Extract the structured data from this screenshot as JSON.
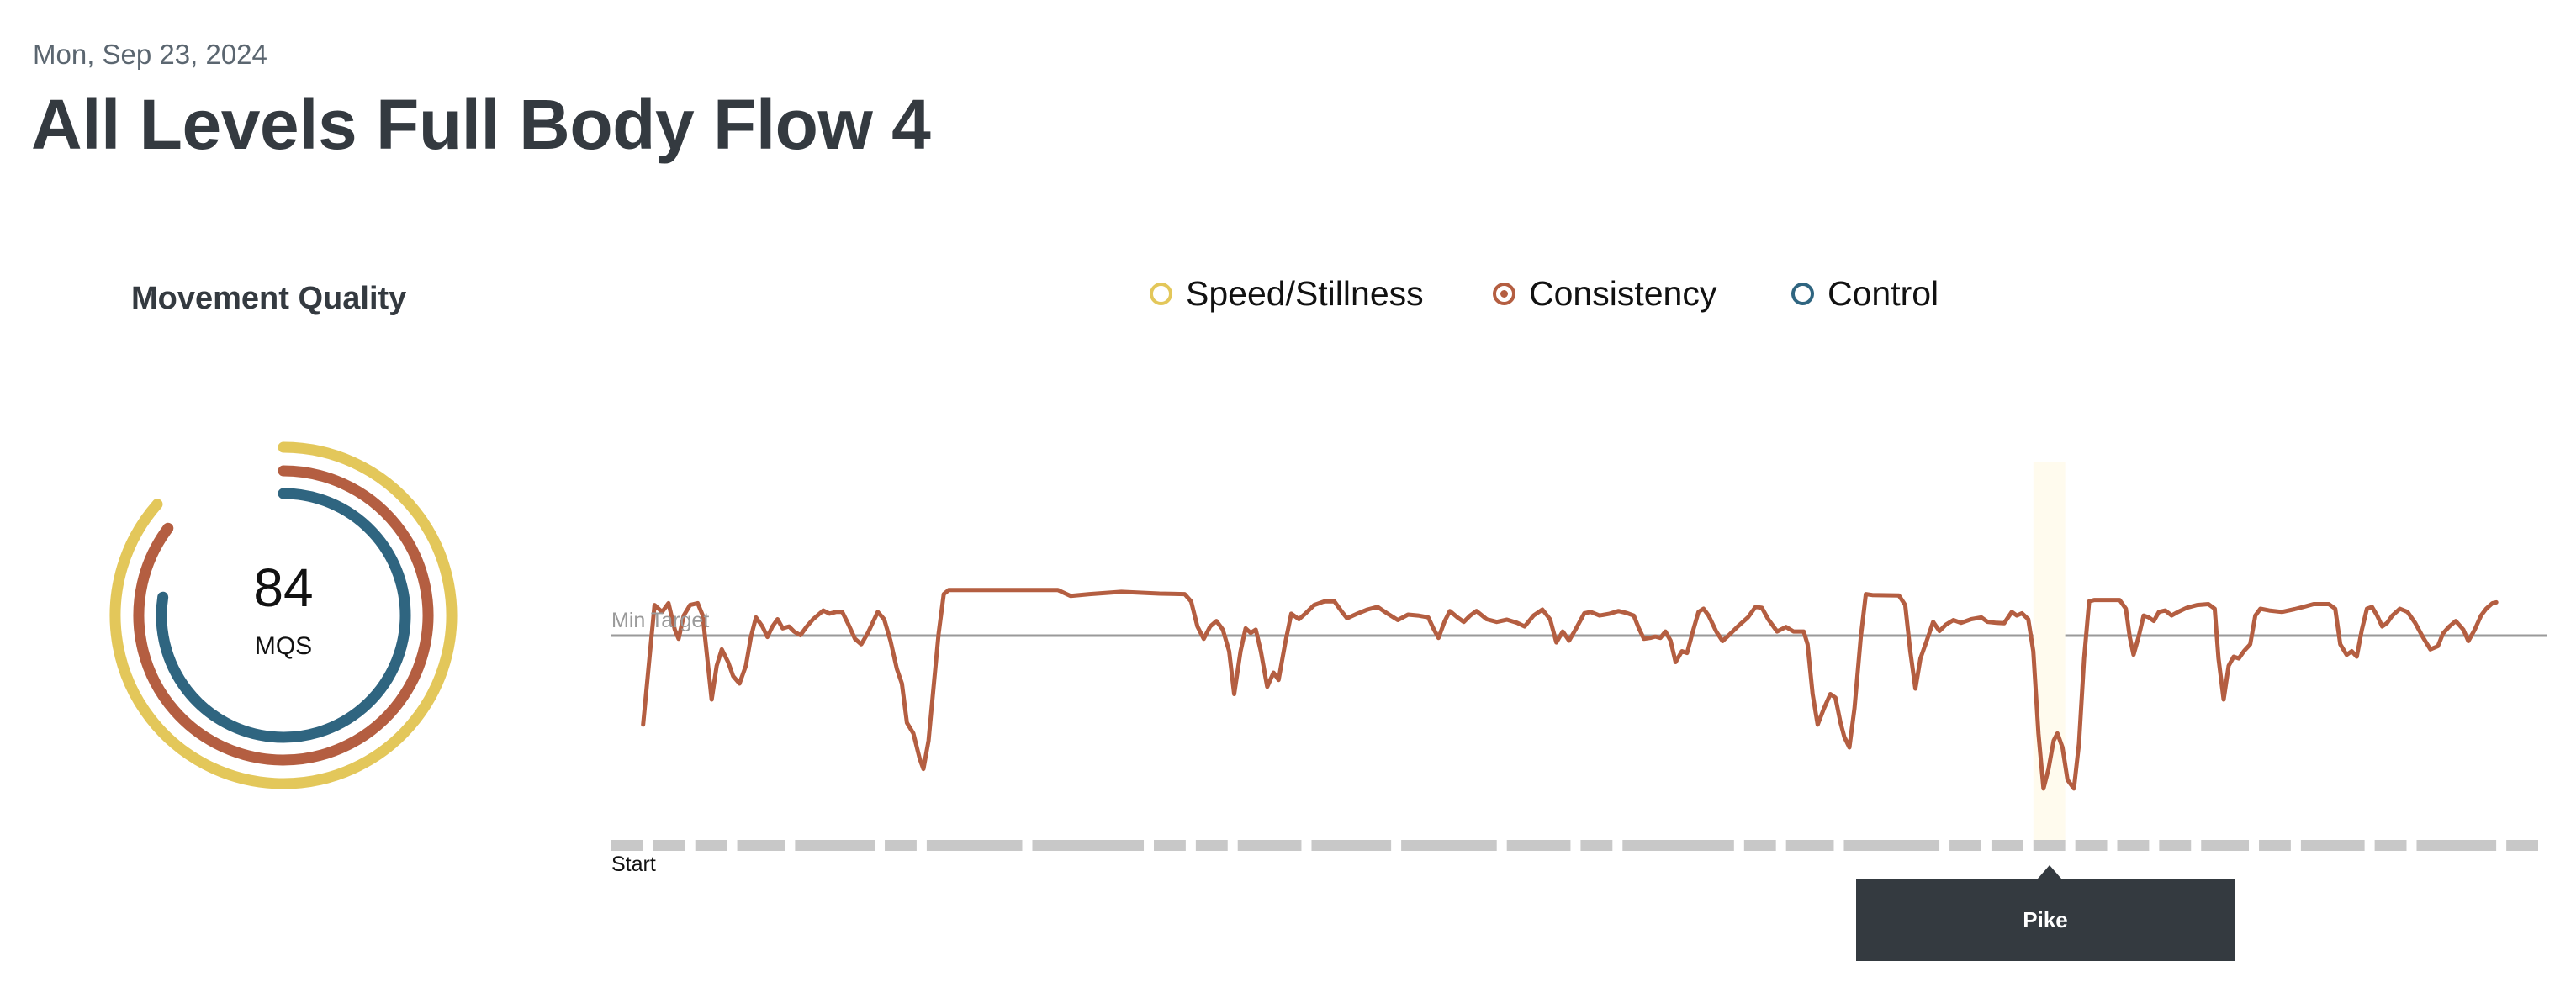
{
  "header": {
    "date": "Mon, Sep 23, 2024",
    "title": "All Levels Full Body Flow 4"
  },
  "movement_quality": {
    "title": "Movement Quality",
    "score": "84",
    "score_label": "MQS",
    "rings": [
      {
        "metric": "Speed/Stillness",
        "fraction": 0.865,
        "color": "#e3c75a"
      },
      {
        "metric": "Consistency",
        "fraction": 0.853,
        "color": "#b45e41"
      },
      {
        "metric": "Control",
        "fraction": 0.774,
        "color": "#2f6580"
      }
    ]
  },
  "legend": [
    {
      "label": "Speed/Stillness",
      "color": "#e3c75a",
      "selected": false
    },
    {
      "label": "Consistency",
      "color": "#b45e41",
      "selected": true
    },
    {
      "label": "Control",
      "color": "#2f6580",
      "selected": false
    }
  ],
  "colors": {
    "line": "#b45e41",
    "min_target": "#9a9a9a",
    "segment": "#c8c8c8",
    "highlight": "#fffbee",
    "tooltip_bg": "#343a40"
  },
  "chart_data": {
    "type": "line",
    "series": [
      {
        "name": "Consistency",
        "color": "#b45e41"
      }
    ],
    "x_range": [
      0,
      1519
    ],
    "y_range": [
      36,
      80
    ],
    "min_target": {
      "label": "Min Target",
      "value": 70
    },
    "start_label": "Start",
    "segment_units": [
      2,
      2,
      2,
      3,
      5,
      2,
      6,
      7,
      2,
      2,
      4,
      5,
      6,
      4,
      2,
      7,
      2,
      3,
      6,
      2,
      2,
      2,
      2,
      2,
      2,
      3,
      2,
      4,
      2,
      5,
      2
    ],
    "highlighted_segment": 21,
    "tooltip": "Pike",
    "points": [
      [
        25,
        50.5
      ],
      [
        30,
        65
      ],
      [
        34,
        76.7
      ],
      [
        40,
        75.2
      ],
      [
        45,
        77.1
      ],
      [
        50,
        71.3
      ],
      [
        53,
        69.3
      ],
      [
        57,
        74.4
      ],
      [
        62,
        76.7
      ],
      [
        68,
        77.1
      ],
      [
        72,
        74.4
      ],
      [
        75,
        66.6
      ],
      [
        79,
        56
      ],
      [
        83,
        63.4
      ],
      [
        87,
        67
      ],
      [
        92,
        64.2
      ],
      [
        96,
        61.1
      ],
      [
        101,
        59.5
      ],
      [
        106,
        63.4
      ],
      [
        110,
        69.7
      ],
      [
        114,
        74
      ],
      [
        119,
        72
      ],
      [
        123,
        69.7
      ],
      [
        127,
        72
      ],
      [
        131,
        73.6
      ],
      [
        135,
        71.6
      ],
      [
        140,
        72
      ],
      [
        144,
        70.9
      ],
      [
        149,
        70.1
      ],
      [
        154,
        72
      ],
      [
        159,
        73.6
      ],
      [
        167,
        75.5
      ],
      [
        172,
        74.8
      ],
      [
        177,
        75.2
      ],
      [
        182,
        75.2
      ],
      [
        187,
        72.4
      ],
      [
        192,
        69.3
      ],
      [
        197,
        68.1
      ],
      [
        202,
        70.5
      ],
      [
        210,
        75.2
      ],
      [
        215,
        73.6
      ],
      [
        220,
        68.9
      ],
      [
        225,
        62.7
      ],
      [
        229,
        59.5
      ],
      [
        233,
        50.9
      ],
      [
        238,
        48.6
      ],
      [
        243,
        43.1
      ],
      [
        246,
        40.8
      ],
      [
        250,
        47
      ],
      [
        254,
        58.8
      ],
      [
        258,
        70.5
      ],
      [
        262,
        79.1
      ],
      [
        266,
        80
      ],
      [
        352,
        80
      ],
      [
        362,
        78.7
      ],
      [
        377,
        79.1
      ],
      [
        402,
        79.6
      ],
      [
        432,
        79.2
      ],
      [
        452,
        79.1
      ],
      [
        457,
        77.5
      ],
      [
        462,
        72
      ],
      [
        467,
        69.3
      ],
      [
        472,
        72
      ],
      [
        477,
        73.2
      ],
      [
        482,
        71.3
      ],
      [
        487,
        66.6
      ],
      [
        491,
        57.2
      ],
      [
        496,
        66.6
      ],
      [
        500,
        71.6
      ],
      [
        504,
        70.6
      ],
      [
        508,
        71.3
      ],
      [
        512,
        66.6
      ],
      [
        517,
        58.8
      ],
      [
        522,
        61.9
      ],
      [
        526,
        60.3
      ],
      [
        531,
        68.1
      ],
      [
        536,
        74.8
      ],
      [
        542,
        73.6
      ],
      [
        547,
        74.8
      ],
      [
        554,
        76.7
      ],
      [
        562,
        77.5
      ],
      [
        570,
        77.5
      ],
      [
        576,
        75.2
      ],
      [
        580,
        73.8
      ],
      [
        588,
        74.8
      ],
      [
        596,
        75.7
      ],
      [
        604,
        76.3
      ],
      [
        612,
        74.8
      ],
      [
        620,
        73.4
      ],
      [
        628,
        74.6
      ],
      [
        636,
        74.4
      ],
      [
        644,
        74
      ],
      [
        648,
        71.6
      ],
      [
        652,
        69.5
      ],
      [
        657,
        73.2
      ],
      [
        661,
        75.4
      ],
      [
        667,
        74
      ],
      [
        672,
        73
      ],
      [
        677,
        74.4
      ],
      [
        682,
        75.4
      ],
      [
        690,
        73.6
      ],
      [
        698,
        73
      ],
      [
        706,
        73.5
      ],
      [
        714,
        72.8
      ],
      [
        720,
        72
      ],
      [
        727,
        74.4
      ],
      [
        734,
        75.7
      ],
      [
        740,
        73.6
      ],
      [
        745,
        68.5
      ],
      [
        750,
        70.9
      ],
      [
        755,
        68.9
      ],
      [
        760,
        71.3
      ],
      [
        767,
        74.9
      ],
      [
        772,
        75.2
      ],
      [
        779,
        74.4
      ],
      [
        787,
        74.8
      ],
      [
        794,
        75.4
      ],
      [
        800,
        75
      ],
      [
        806,
        74.4
      ],
      [
        810,
        71.6
      ],
      [
        814,
        69.3
      ],
      [
        819,
        69.5
      ],
      [
        823,
        69.8
      ],
      [
        827,
        69.5
      ],
      [
        831,
        70.9
      ],
      [
        835,
        68.9
      ],
      [
        839,
        64.2
      ],
      [
        844,
        66.6
      ],
      [
        848,
        66.2
      ],
      [
        853,
        71.3
      ],
      [
        857,
        75.2
      ],
      [
        861,
        75.9
      ],
      [
        865,
        74.4
      ],
      [
        871,
        70.9
      ],
      [
        876,
        68.8
      ],
      [
        881,
        70.1
      ],
      [
        888,
        72
      ],
      [
        896,
        74
      ],
      [
        902,
        76.3
      ],
      [
        907,
        76.1
      ],
      [
        912,
        73.6
      ],
      [
        919,
        70.9
      ],
      [
        926,
        71.9
      ],
      [
        932,
        70.9
      ],
      [
        940,
        70.9
      ],
      [
        943,
        68.1
      ],
      [
        947,
        57.2
      ],
      [
        951,
        50.5
      ],
      [
        956,
        54.1
      ],
      [
        961,
        57.2
      ],
      [
        965,
        56.4
      ],
      [
        969,
        50.9
      ],
      [
        972,
        47.8
      ],
      [
        976,
        45.5
      ],
      [
        980,
        54.1
      ],
      [
        985,
        69.7
      ],
      [
        989,
        79.1
      ],
      [
        994,
        78.9
      ],
      [
        1015,
        78.8
      ],
      [
        1020,
        76.7
      ],
      [
        1024,
        66.6
      ],
      [
        1028,
        58.4
      ],
      [
        1032,
        65
      ],
      [
        1037,
        68.9
      ],
      [
        1042,
        73
      ],
      [
        1047,
        71
      ],
      [
        1052,
        72.4
      ],
      [
        1058,
        73.4
      ],
      [
        1064,
        72.8
      ],
      [
        1072,
        73.6
      ],
      [
        1080,
        74
      ],
      [
        1085,
        73
      ],
      [
        1092,
        72.8
      ],
      [
        1098,
        72.7
      ],
      [
        1104,
        75.2
      ],
      [
        1108,
        74.4
      ],
      [
        1112,
        74.9
      ],
      [
        1117,
        73.6
      ],
      [
        1121,
        66.6
      ],
      [
        1125,
        48.6
      ],
      [
        1129,
        36.5
      ],
      [
        1133,
        40.8
      ],
      [
        1137,
        47
      ],
      [
        1140,
        48.6
      ],
      [
        1144,
        45.5
      ],
      [
        1148,
        38.4
      ],
      [
        1153,
        36.5
      ],
      [
        1157,
        46.3
      ],
      [
        1161,
        65
      ],
      [
        1165,
        77.5
      ],
      [
        1169,
        77.8
      ],
      [
        1189,
        77.8
      ],
      [
        1194,
        75.9
      ],
      [
        1197,
        69.7
      ],
      [
        1200,
        65.8
      ],
      [
        1204,
        69.7
      ],
      [
        1208,
        74.4
      ],
      [
        1212,
        74
      ],
      [
        1216,
        73.2
      ],
      [
        1220,
        75.2
      ],
      [
        1225,
        75.5
      ],
      [
        1230,
        74.4
      ],
      [
        1235,
        75.2
      ],
      [
        1242,
        76.1
      ],
      [
        1250,
        76.7
      ],
      [
        1259,
        76.9
      ],
      [
        1264,
        75.9
      ],
      [
        1267,
        65
      ],
      [
        1271,
        56
      ],
      [
        1275,
        63.4
      ],
      [
        1279,
        65.4
      ],
      [
        1283,
        65
      ],
      [
        1287,
        66.6
      ],
      [
        1292,
        68.1
      ],
      [
        1296,
        74.4
      ],
      [
        1300,
        75.9
      ],
      [
        1307,
        75.5
      ],
      [
        1317,
        75.2
      ],
      [
        1327,
        75.8
      ],
      [
        1334,
        76.3
      ],
      [
        1342,
        76.9
      ],
      [
        1354,
        76.9
      ],
      [
        1359,
        75.9
      ],
      [
        1363,
        68.1
      ],
      [
        1368,
        65.8
      ],
      [
        1372,
        66.6
      ],
      [
        1376,
        65.4
      ],
      [
        1380,
        71.3
      ],
      [
        1384,
        75.9
      ],
      [
        1388,
        76.3
      ],
      [
        1392,
        74.4
      ],
      [
        1396,
        72
      ],
      [
        1400,
        72.8
      ],
      [
        1404,
        74.4
      ],
      [
        1410,
        75.9
      ],
      [
        1416,
        75.2
      ],
      [
        1422,
        72.8
      ],
      [
        1428,
        69.7
      ],
      [
        1434,
        67
      ],
      [
        1440,
        67.7
      ],
      [
        1444,
        70.5
      ],
      [
        1449,
        72
      ],
      [
        1454,
        73.2
      ],
      [
        1460,
        71.3
      ],
      [
        1464,
        68.8
      ],
      [
        1469,
        71.3
      ],
      [
        1474,
        74.4
      ],
      [
        1478,
        75.9
      ],
      [
        1483,
        77.1
      ],
      [
        1486,
        77.3
      ]
    ]
  }
}
